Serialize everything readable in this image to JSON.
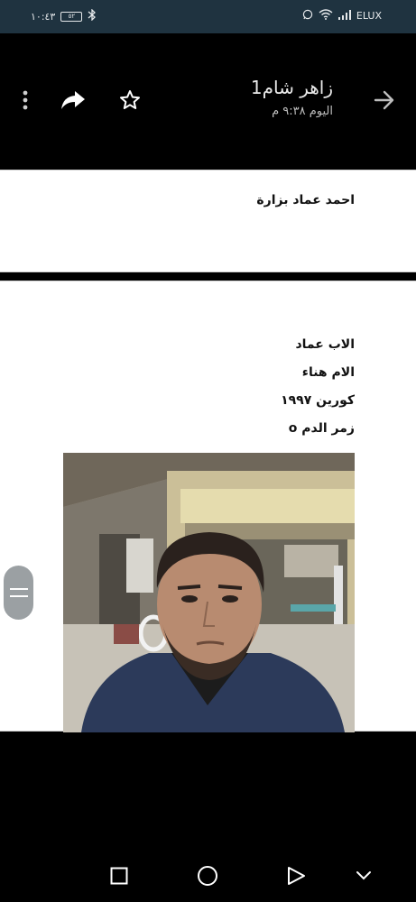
{
  "status_bar": {
    "time": "١٠:٤٣",
    "battery": "٥٢",
    "carrier": "ELUX"
  },
  "header": {
    "title": "زاهر شام1",
    "timestamp": "اليوم ٩:٣٨ م",
    "icons": [
      "more-vert-icon",
      "share-icon",
      "star-icon",
      "forward-arrow-icon"
    ]
  },
  "message": {
    "name_line": "احمد عماد بزارة",
    "lines": [
      "الاب عماد",
      "الام هناء",
      "كورين ١٩٩٧",
      "زمر الدم o"
    ]
  },
  "nav": {
    "icons": [
      "recent-apps-icon",
      "home-icon",
      "back-icon",
      "hide-nav-icon"
    ]
  },
  "colors": {
    "status_bg": "#1f3340",
    "header_bg": "#000000",
    "card_bg": "#ffffff",
    "scroll_handle": "#9ba0a3"
  }
}
